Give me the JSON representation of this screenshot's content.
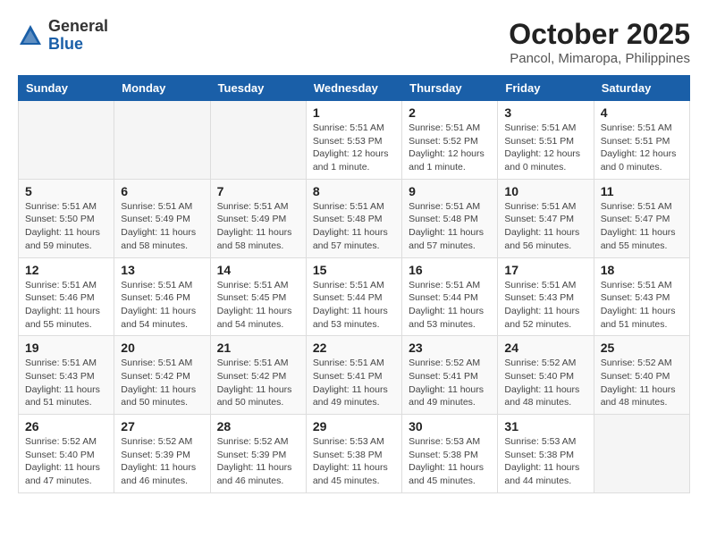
{
  "header": {
    "logo_general": "General",
    "logo_blue": "Blue",
    "title": "October 2025",
    "subtitle": "Pancol, Mimaropa, Philippines"
  },
  "days_of_week": [
    "Sunday",
    "Monday",
    "Tuesday",
    "Wednesday",
    "Thursday",
    "Friday",
    "Saturday"
  ],
  "weeks": [
    [
      {
        "day": "",
        "sunrise": "",
        "sunset": "",
        "daylight": ""
      },
      {
        "day": "",
        "sunrise": "",
        "sunset": "",
        "daylight": ""
      },
      {
        "day": "",
        "sunrise": "",
        "sunset": "",
        "daylight": ""
      },
      {
        "day": "1",
        "sunrise": "Sunrise: 5:51 AM",
        "sunset": "Sunset: 5:53 PM",
        "daylight": "Daylight: 12 hours and 1 minute."
      },
      {
        "day": "2",
        "sunrise": "Sunrise: 5:51 AM",
        "sunset": "Sunset: 5:52 PM",
        "daylight": "Daylight: 12 hours and 1 minute."
      },
      {
        "day": "3",
        "sunrise": "Sunrise: 5:51 AM",
        "sunset": "Sunset: 5:51 PM",
        "daylight": "Daylight: 12 hours and 0 minutes."
      },
      {
        "day": "4",
        "sunrise": "Sunrise: 5:51 AM",
        "sunset": "Sunset: 5:51 PM",
        "daylight": "Daylight: 12 hours and 0 minutes."
      }
    ],
    [
      {
        "day": "5",
        "sunrise": "Sunrise: 5:51 AM",
        "sunset": "Sunset: 5:50 PM",
        "daylight": "Daylight: 11 hours and 59 minutes."
      },
      {
        "day": "6",
        "sunrise": "Sunrise: 5:51 AM",
        "sunset": "Sunset: 5:49 PM",
        "daylight": "Daylight: 11 hours and 58 minutes."
      },
      {
        "day": "7",
        "sunrise": "Sunrise: 5:51 AM",
        "sunset": "Sunset: 5:49 PM",
        "daylight": "Daylight: 11 hours and 58 minutes."
      },
      {
        "day": "8",
        "sunrise": "Sunrise: 5:51 AM",
        "sunset": "Sunset: 5:48 PM",
        "daylight": "Daylight: 11 hours and 57 minutes."
      },
      {
        "day": "9",
        "sunrise": "Sunrise: 5:51 AM",
        "sunset": "Sunset: 5:48 PM",
        "daylight": "Daylight: 11 hours and 57 minutes."
      },
      {
        "day": "10",
        "sunrise": "Sunrise: 5:51 AM",
        "sunset": "Sunset: 5:47 PM",
        "daylight": "Daylight: 11 hours and 56 minutes."
      },
      {
        "day": "11",
        "sunrise": "Sunrise: 5:51 AM",
        "sunset": "Sunset: 5:47 PM",
        "daylight": "Daylight: 11 hours and 55 minutes."
      }
    ],
    [
      {
        "day": "12",
        "sunrise": "Sunrise: 5:51 AM",
        "sunset": "Sunset: 5:46 PM",
        "daylight": "Daylight: 11 hours and 55 minutes."
      },
      {
        "day": "13",
        "sunrise": "Sunrise: 5:51 AM",
        "sunset": "Sunset: 5:46 PM",
        "daylight": "Daylight: 11 hours and 54 minutes."
      },
      {
        "day": "14",
        "sunrise": "Sunrise: 5:51 AM",
        "sunset": "Sunset: 5:45 PM",
        "daylight": "Daylight: 11 hours and 54 minutes."
      },
      {
        "day": "15",
        "sunrise": "Sunrise: 5:51 AM",
        "sunset": "Sunset: 5:44 PM",
        "daylight": "Daylight: 11 hours and 53 minutes."
      },
      {
        "day": "16",
        "sunrise": "Sunrise: 5:51 AM",
        "sunset": "Sunset: 5:44 PM",
        "daylight": "Daylight: 11 hours and 53 minutes."
      },
      {
        "day": "17",
        "sunrise": "Sunrise: 5:51 AM",
        "sunset": "Sunset: 5:43 PM",
        "daylight": "Daylight: 11 hours and 52 minutes."
      },
      {
        "day": "18",
        "sunrise": "Sunrise: 5:51 AM",
        "sunset": "Sunset: 5:43 PM",
        "daylight": "Daylight: 11 hours and 51 minutes."
      }
    ],
    [
      {
        "day": "19",
        "sunrise": "Sunrise: 5:51 AM",
        "sunset": "Sunset: 5:43 PM",
        "daylight": "Daylight: 11 hours and 51 minutes."
      },
      {
        "day": "20",
        "sunrise": "Sunrise: 5:51 AM",
        "sunset": "Sunset: 5:42 PM",
        "daylight": "Daylight: 11 hours and 50 minutes."
      },
      {
        "day": "21",
        "sunrise": "Sunrise: 5:51 AM",
        "sunset": "Sunset: 5:42 PM",
        "daylight": "Daylight: 11 hours and 50 minutes."
      },
      {
        "day": "22",
        "sunrise": "Sunrise: 5:51 AM",
        "sunset": "Sunset: 5:41 PM",
        "daylight": "Daylight: 11 hours and 49 minutes."
      },
      {
        "day": "23",
        "sunrise": "Sunrise: 5:52 AM",
        "sunset": "Sunset: 5:41 PM",
        "daylight": "Daylight: 11 hours and 49 minutes."
      },
      {
        "day": "24",
        "sunrise": "Sunrise: 5:52 AM",
        "sunset": "Sunset: 5:40 PM",
        "daylight": "Daylight: 11 hours and 48 minutes."
      },
      {
        "day": "25",
        "sunrise": "Sunrise: 5:52 AM",
        "sunset": "Sunset: 5:40 PM",
        "daylight": "Daylight: 11 hours and 48 minutes."
      }
    ],
    [
      {
        "day": "26",
        "sunrise": "Sunrise: 5:52 AM",
        "sunset": "Sunset: 5:40 PM",
        "daylight": "Daylight: 11 hours and 47 minutes."
      },
      {
        "day": "27",
        "sunrise": "Sunrise: 5:52 AM",
        "sunset": "Sunset: 5:39 PM",
        "daylight": "Daylight: 11 hours and 46 minutes."
      },
      {
        "day": "28",
        "sunrise": "Sunrise: 5:52 AM",
        "sunset": "Sunset: 5:39 PM",
        "daylight": "Daylight: 11 hours and 46 minutes."
      },
      {
        "day": "29",
        "sunrise": "Sunrise: 5:53 AM",
        "sunset": "Sunset: 5:38 PM",
        "daylight": "Daylight: 11 hours and 45 minutes."
      },
      {
        "day": "30",
        "sunrise": "Sunrise: 5:53 AM",
        "sunset": "Sunset: 5:38 PM",
        "daylight": "Daylight: 11 hours and 45 minutes."
      },
      {
        "day": "31",
        "sunrise": "Sunrise: 5:53 AM",
        "sunset": "Sunset: 5:38 PM",
        "daylight": "Daylight: 11 hours and 44 minutes."
      },
      {
        "day": "",
        "sunrise": "",
        "sunset": "",
        "daylight": ""
      }
    ]
  ]
}
